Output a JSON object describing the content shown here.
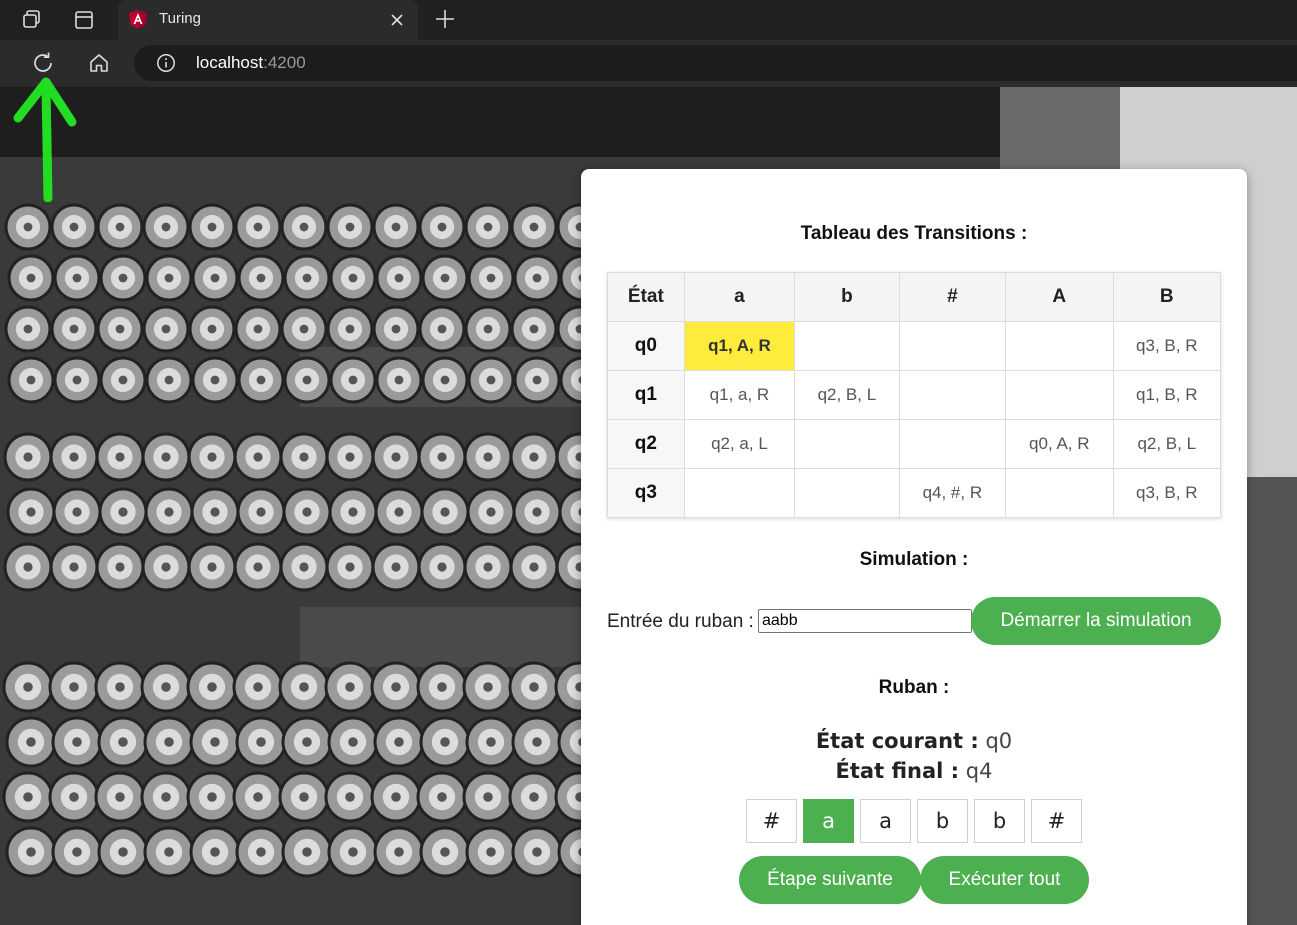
{
  "browser": {
    "tab": {
      "title": "Turing"
    },
    "url": {
      "host": "localhost",
      "port": ":4200"
    }
  },
  "colors": {
    "accent": "#4caf50",
    "highlight": "#ffeb3b",
    "annotation": "#22dd22"
  },
  "icons": {
    "workspaces": "workspaces-icon",
    "tab_actions": "tab-actions-icon",
    "favicon": "angular-icon",
    "close": "close-icon",
    "new_tab": "plus-icon",
    "refresh": "refresh-icon",
    "home": "home-icon",
    "info": "info-icon"
  },
  "transitions": {
    "title": "Tableau des Transitions :",
    "headers": [
      "État",
      "a",
      "b",
      "#",
      "A",
      "B"
    ],
    "rows": [
      {
        "state": "q0",
        "cells": [
          "q1, A, R",
          "",
          "",
          "",
          "q3, B, R"
        ],
        "highlight": 0
      },
      {
        "state": "q1",
        "cells": [
          "q1, a, R",
          "q2, B, L",
          "",
          "",
          "q1, B, R"
        ]
      },
      {
        "state": "q2",
        "cells": [
          "q2, a, L",
          "",
          "",
          "q0, A, R",
          "q2, B, L"
        ]
      },
      {
        "state": "q3",
        "cells": [
          "",
          "",
          "q4, #, R",
          "",
          "q3, B, R"
        ]
      }
    ]
  },
  "simulation": {
    "title": "Simulation :",
    "input_label": "Entrée du ruban :",
    "input_value": "aabb",
    "start_button": "Démarrer la simulation"
  },
  "ruban": {
    "title": "Ruban :",
    "current_label": "État courant :",
    "current_value": "q0",
    "final_label": "État final :",
    "final_value": "q4",
    "cells": [
      "#",
      "a",
      "a",
      "b",
      "b",
      "#"
    ],
    "head_index": 1,
    "next_button": "Étape suivante",
    "run_all_button": "Exécuter tout"
  }
}
